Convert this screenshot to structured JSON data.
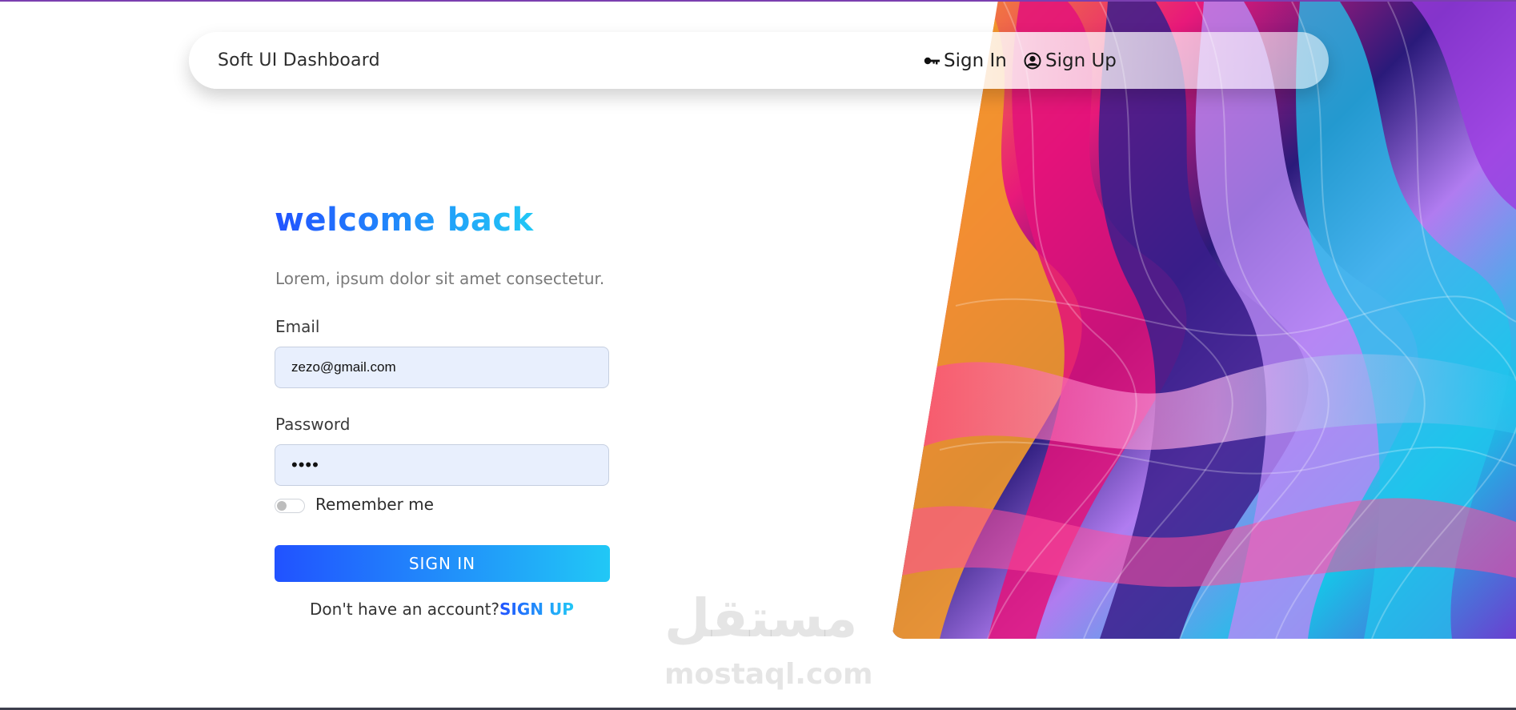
{
  "navbar": {
    "brand": "Soft UI Dashboard",
    "signin_label": "Sign In",
    "signup_label": "Sign Up",
    "signin_icon": "key-icon",
    "signup_icon": "user-circle-icon"
  },
  "form": {
    "title": "welcome back",
    "subtitle": "Lorem, ipsum dolor sit amet consectetur.",
    "email_label": "Email",
    "email_value": "zezo@gmail.com",
    "password_label": "Password",
    "password_value": "1234",
    "remember_label": "Remember me",
    "remember_checked": false,
    "submit_label": "SIGN IN",
    "signup_prompt": "Don't have an account?",
    "signup_link": "SIGN UP"
  },
  "watermark": {
    "arabic": "مستقل",
    "domain": "mostaql.com"
  },
  "colors": {
    "gradient_start": "#2152ff",
    "gradient_end": "#21c8f6",
    "input_bg": "#e8effd"
  }
}
